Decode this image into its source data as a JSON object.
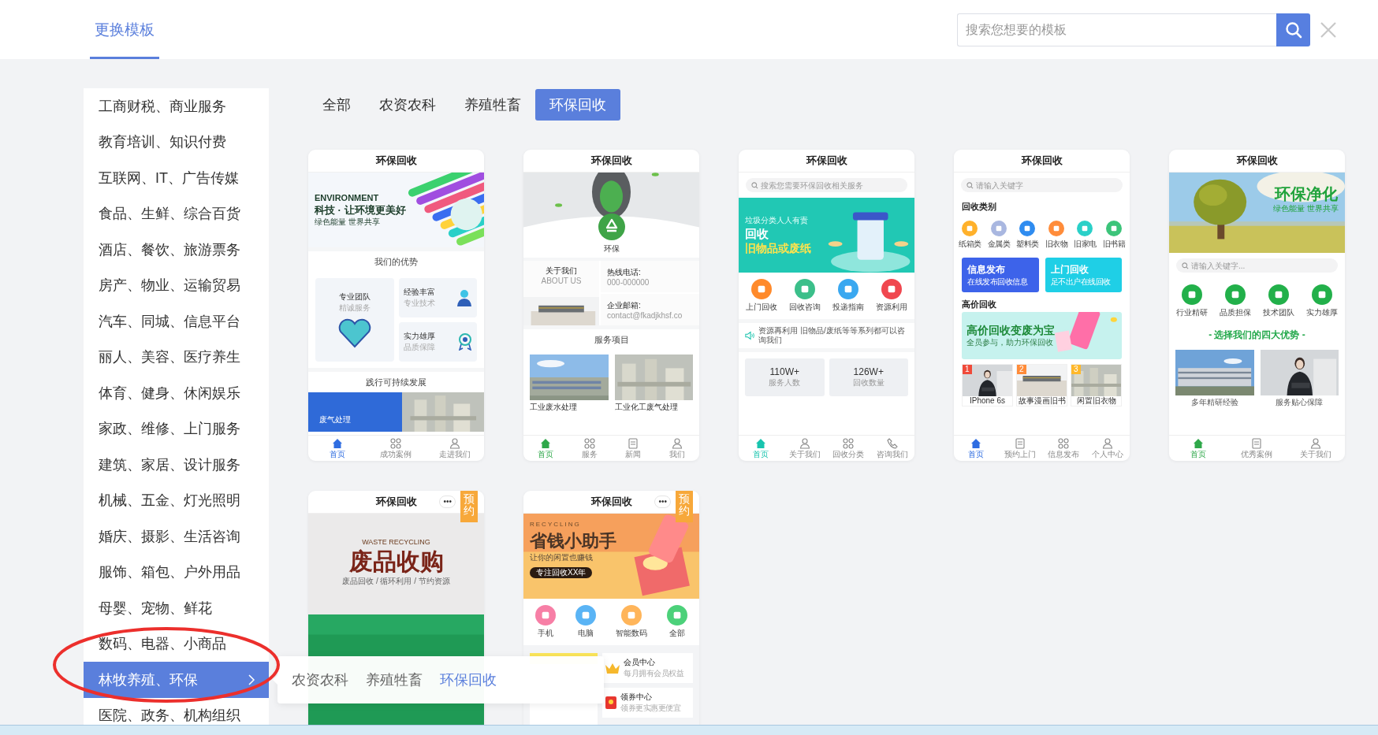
{
  "header": {
    "tab": {
      "label": "更换模板",
      "selected": true
    },
    "search": {
      "placeholder": "搜索您想要的模板"
    }
  },
  "sidebar": {
    "items": [
      {
        "label": "工商财税、商业服务",
        "selected": false
      },
      {
        "label": "教育培训、知识付费",
        "selected": false
      },
      {
        "label": "互联网、IT、广告传媒",
        "selected": false
      },
      {
        "label": "食品、生鲜、综合百货",
        "selected": false
      },
      {
        "label": "酒店、餐饮、旅游票务",
        "selected": false
      },
      {
        "label": "房产、物业、运输贸易",
        "selected": false
      },
      {
        "label": "汽车、同城、信息平台",
        "selected": false
      },
      {
        "label": "丽人、美容、医疗养生",
        "selected": false
      },
      {
        "label": "体育、健身、休闲娱乐",
        "selected": false
      },
      {
        "label": "家政、维修、上门服务",
        "selected": false
      },
      {
        "label": "建筑、家居、设计服务",
        "selected": false
      },
      {
        "label": "机械、五金、灯光照明",
        "selected": false
      },
      {
        "label": "婚庆、摄影、生活咨询",
        "selected": false
      },
      {
        "label": "服饰、箱包、户外用品",
        "selected": false
      },
      {
        "label": "母婴、宠物、鲜花",
        "selected": false
      },
      {
        "label": "数码、电器、小商品",
        "selected": false
      },
      {
        "label": "林牧养殖、环保",
        "selected": true
      },
      {
        "label": "医院、政务、机构组织",
        "selected": false
      }
    ]
  },
  "filters": [
    {
      "label": "全部",
      "selected": false
    },
    {
      "label": "农资农科",
      "selected": false
    },
    {
      "label": "养殖牲畜",
      "selected": false
    },
    {
      "label": "环保回收",
      "selected": true
    }
  ],
  "templates": [
    {
      "title": "环保回收",
      "sections": [
        {
          "kind": "banner",
          "lines": [
            {
              "kind": "latin",
              "text": "ENVIRONMENT"
            },
            {
              "kind": "headline",
              "text": "科技 · 让环境更美好"
            },
            {
              "kind": "caption",
              "text": "绿色能量 世界共享"
            }
          ]
        },
        {
          "kind": "heading",
          "text": "我们的优势"
        },
        {
          "kind": "tiles",
          "items": [
            {
              "title": "专业团队",
              "sub": "精诚服务"
            },
            {
              "title": "经验丰富",
              "sub": "专业技术"
            },
            {
              "title": "实力雄厚",
              "sub": "品质保障"
            }
          ]
        },
        {
          "kind": "heading",
          "text": "践行可持续发展"
        },
        {
          "kind": "split",
          "caption": "废气处理"
        }
      ],
      "nav": [
        {
          "kind": "home",
          "label": "首页",
          "selected": true
        },
        {
          "kind": "grid",
          "label": "成功案例",
          "selected": false
        },
        {
          "kind": "user",
          "label": "走进我们",
          "selected": false
        }
      ]
    },
    {
      "title": "环保回收",
      "sections": [
        {
          "kind": "hero",
          "caption": "环保"
        },
        {
          "kind": "contact",
          "items": [
            {
              "title": "关于我们",
              "sub": "ABOUT US"
            },
            {
              "title": "热线电话:",
              "sub": "000-000000"
            },
            {
              "title": "企业邮箱:",
              "sub": "contact@fkadjkhsf.co"
            }
          ]
        },
        {
          "kind": "heading",
          "text": "服务项目"
        },
        {
          "kind": "photos",
          "items": [
            {
              "caption": "工业废水处理"
            },
            {
              "caption": "工业化工废气处理"
            }
          ]
        }
      ],
      "nav": [
        {
          "kind": "home",
          "label": "首页",
          "selected": true
        },
        {
          "kind": "grid",
          "label": "服务",
          "selected": false
        },
        {
          "kind": "doc",
          "label": "新闻",
          "selected": false
        },
        {
          "kind": "user",
          "label": "我们",
          "selected": false
        }
      ]
    },
    {
      "title": "环保回收",
      "sections": [
        {
          "kind": "search",
          "placeholder": "搜索您需要环保回收相关服务"
        },
        {
          "kind": "banner",
          "lines": [
            {
              "kind": "caption",
              "text": "垃圾分类人人有责"
            },
            {
              "kind": "headline",
              "text": "回收"
            },
            {
              "kind": "accent",
              "text": "旧物品或废纸"
            }
          ]
        },
        {
          "kind": "icons",
          "items": [
            {
              "label": "上门回收",
              "color": "#ff8a2b"
            },
            {
              "label": "回收咨询",
              "color": "#3bbf8a"
            },
            {
              "label": "投递指南",
              "color": "#3aa8f0"
            },
            {
              "label": "资源利用",
              "color": "#f0474f"
            }
          ]
        },
        {
          "kind": "notice",
          "text": "资源再利用 旧物品/废纸等等系列都可以咨询我们"
        },
        {
          "kind": "stats",
          "items": [
            {
              "value": "110W+",
              "label": "服务人数"
            },
            {
              "value": "126W+",
              "label": "回收数量"
            }
          ]
        }
      ],
      "nav": [
        {
          "kind": "home",
          "label": "首页",
          "selected": true
        },
        {
          "kind": "user",
          "label": "关于我们",
          "selected": false
        },
        {
          "kind": "grid",
          "label": "回收分类",
          "selected": false
        },
        {
          "kind": "phone",
          "label": "咨询我们",
          "selected": false
        }
      ]
    },
    {
      "title": "环保回收",
      "sections": [
        {
          "kind": "search",
          "placeholder": "请输入关键字"
        },
        {
          "kind": "label",
          "text": "回收类别"
        },
        {
          "kind": "icons",
          "items": [
            {
              "label": "纸箱类",
              "color": "#ffb12b"
            },
            {
              "label": "金属类",
              "color": "#a9b7e0"
            },
            {
              "label": "塑料类",
              "color": "#2f8cf0"
            },
            {
              "label": "旧衣物",
              "color": "#ff8c3a"
            },
            {
              "label": "旧家电",
              "color": "#2ad0c8"
            },
            {
              "label": "旧书籍",
              "color": "#3cc47a"
            }
          ]
        },
        {
          "kind": "actions",
          "items": [
            {
              "title": "信息发布",
              "sub": "在线发布回收信息",
              "color": "#3d63ea"
            },
            {
              "title": "上门回收",
              "sub": "足不出户在线回收",
              "color": "#1fcfe6"
            }
          ]
        },
        {
          "kind": "label",
          "text": "高价回收"
        },
        {
          "kind": "promo",
          "lines": [
            {
              "kind": "headline",
              "text": "高价回收变废为宝"
            },
            {
              "kind": "caption",
              "text": "全员参与，助力环保回收"
            }
          ]
        },
        {
          "kind": "products",
          "items": [
            {
              "rank": "1",
              "name": "IPhone 6s",
              "color": "#f04a3a"
            },
            {
              "rank": "2",
              "name": "故事漫画旧书",
              "color": "#ff8c3a"
            },
            {
              "rank": "3",
              "name": "闲置旧衣物",
              "color": "#ffb82b"
            }
          ]
        }
      ],
      "nav": [
        {
          "kind": "home",
          "label": "首页",
          "selected": true
        },
        {
          "kind": "doc",
          "label": "预约上门",
          "selected": false
        },
        {
          "kind": "grid",
          "label": "信息发布",
          "selected": false
        },
        {
          "kind": "user",
          "label": "个人中心",
          "selected": false
        }
      ]
    },
    {
      "title": "环保回收",
      "sections": [
        {
          "kind": "banner",
          "lines": [
            {
              "kind": "headline",
              "text": "环保净化"
            },
            {
              "kind": "caption",
              "text": "绿色能量 世界共享"
            }
          ]
        },
        {
          "kind": "search",
          "placeholder": "请输入关键字..."
        },
        {
          "kind": "icons",
          "items": [
            {
              "label": "行业精研",
              "color": "#22b04a"
            },
            {
              "label": "品质担保",
              "color": "#22b04a"
            },
            {
              "label": "技术团队",
              "color": "#22b04a"
            },
            {
              "label": "实力雄厚",
              "color": "#22b04a"
            }
          ]
        },
        {
          "kind": "heading",
          "text": "- 选择我们的四大优势 -"
        },
        {
          "kind": "photos",
          "items": [
            {
              "caption": "多年精研经验"
            },
            {
              "caption": "服务贴心保障"
            }
          ]
        }
      ],
      "nav": [
        {
          "kind": "home",
          "label": "首页",
          "selected": true
        },
        {
          "kind": "doc",
          "label": "优秀案例",
          "selected": false
        },
        {
          "kind": "user",
          "label": "关于我们",
          "selected": false
        }
      ]
    },
    {
      "title": "环保回收",
      "menu": "•••",
      "badge": "预约",
      "sections": [
        {
          "kind": "poster",
          "lines": [
            {
              "kind": "latin",
              "text": "WASTE RECYCLING"
            },
            {
              "kind": "headline",
              "text": "废品收购"
            },
            {
              "kind": "caption",
              "text": "废品回收 / 循环利用 / 节约资源"
            }
          ]
        }
      ]
    },
    {
      "title": "环保回收",
      "menu": "•••",
      "badge": "预约",
      "sections": [
        {
          "kind": "banner",
          "lines": [
            {
              "kind": "latin",
              "text": "RECYCLING"
            },
            {
              "kind": "headline",
              "text": "省钱小助手"
            },
            {
              "kind": "caption",
              "text": "让你的闲置也赚钱"
            },
            {
              "kind": "pill",
              "text": "专注回收XX年"
            }
          ]
        },
        {
          "kind": "icons",
          "items": [
            {
              "label": "手机",
              "color": "#f77fa6"
            },
            {
              "label": "电脑",
              "color": "#5ab4f5"
            },
            {
              "label": "智能数码",
              "color": "#ffb55a"
            },
            {
              "label": "全部",
              "color": "#4cd17a"
            }
          ]
        },
        {
          "kind": "services",
          "items": [
            {
              "title": "会员中心",
              "sub": "每月拥有会员权益"
            },
            {
              "title": "领券中心",
              "sub": "领券更实惠更便宜"
            }
          ]
        }
      ]
    }
  ],
  "popover": {
    "items": [
      {
        "label": "农资农科",
        "selected": false
      },
      {
        "label": "养殖牲畜",
        "selected": false
      },
      {
        "label": "环保回收",
        "selected": true
      }
    ]
  },
  "annotation": {
    "kind": "ellipse"
  }
}
